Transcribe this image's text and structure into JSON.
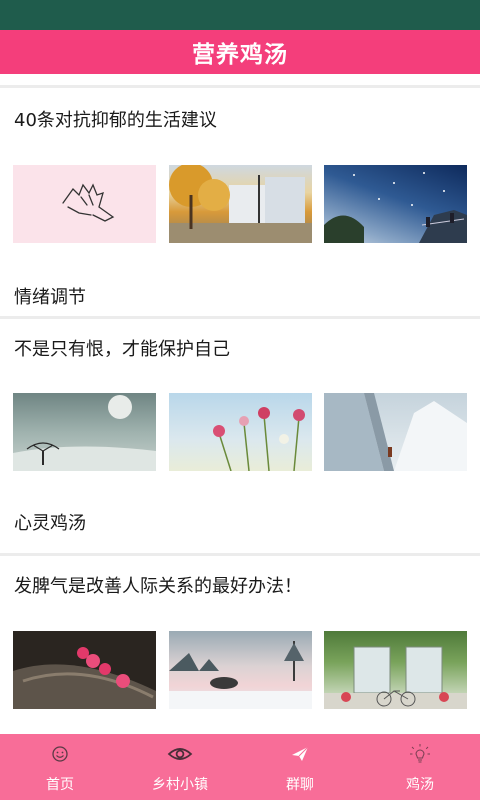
{
  "header": {
    "title": "营养鸡汤"
  },
  "feed": {
    "articles": [
      {
        "title": "40条对抗抑郁的生活建议",
        "category": "情绪调节",
        "thumbnails": [
          "hands-sketch-image",
          "autumn-street-image",
          "starry-sky-image"
        ]
      },
      {
        "title": "不是只有恨，才能保护自己",
        "category": "心灵鸡汤",
        "thumbnails": [
          "moon-tree-image",
          "pink-flowers-image",
          "snow-cliff-image"
        ]
      },
      {
        "title": "发脾气是改善人际关系的最好办法！",
        "category": "",
        "thumbnails": [
          "pink-blossom-log-image",
          "snowy-lake-image",
          "window-bicycle-image"
        ]
      }
    ]
  },
  "bottom_nav": {
    "items": [
      {
        "label": "首页",
        "icon": "smiley-icon"
      },
      {
        "label": "乡村小镇",
        "icon": "eye-icon"
      },
      {
        "label": "群聊",
        "icon": "paper-plane-icon"
      },
      {
        "label": "鸡汤",
        "icon": "lightbulb-icon"
      }
    ]
  },
  "colors": {
    "status_bar": "#1f5c4c",
    "title_bar": "#f43e7b",
    "bottom_nav": "#f86d98",
    "divider": "#ececec"
  }
}
